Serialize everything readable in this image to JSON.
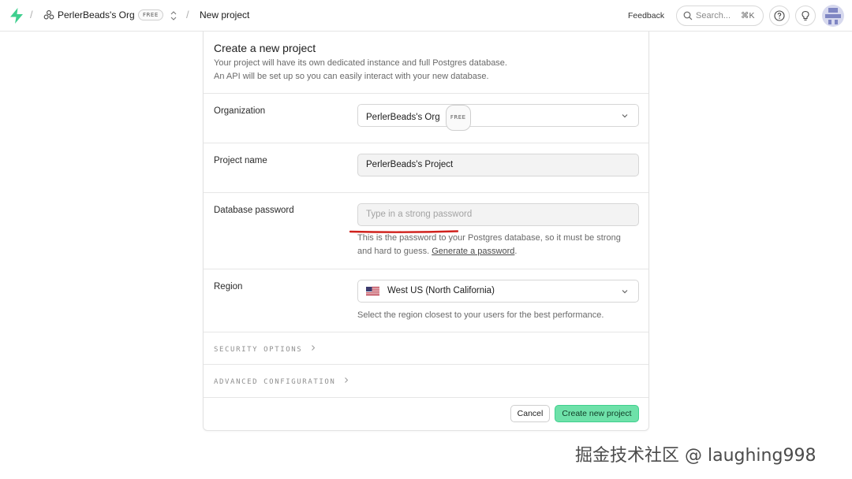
{
  "topbar": {
    "org_name": "PerlerBeads's Org",
    "org_badge": "FREE",
    "project_crumb": "New project",
    "feedback_label": "Feedback",
    "search_placeholder": "Search...",
    "search_shortcut": "⌘K",
    "icons": [
      "supabase-logo-icon",
      "org-icon",
      "switch-icon",
      "search-icon",
      "help-icon",
      "lightbulb-icon",
      "avatar"
    ]
  },
  "form": {
    "title": "Create a new project",
    "description_line1": "Your project will have its own dedicated instance and full Postgres database.",
    "description_line2": "An API will be set up so you can easily interact with your new database.",
    "organization": {
      "label": "Organization",
      "value": "PerlerBeads's Org",
      "badge": "FREE"
    },
    "project_name": {
      "label": "Project name",
      "value": "PerlerBeads's Project"
    },
    "database_password": {
      "label": "Database password",
      "value": "",
      "placeholder": "Type in a strong password",
      "helper_text": "This is the password to your Postgres database, so it must be strong and hard to guess.",
      "helper_link": "Generate a password",
      "helper_end": "."
    },
    "region": {
      "label": "Region",
      "value": "West US (North California)",
      "helper_text": "Select the region closest to your users for the best performance."
    },
    "security_options_label": "SECURITY OPTIONS",
    "advanced_configuration_label": "ADVANCED CONFIGURATION",
    "cancel_label": "Cancel",
    "create_label": "Create new project"
  },
  "colors": {
    "brand_green": "#3ecf8e",
    "create_button_bg": "#6ee1a9",
    "annotation_red": "#d0211c"
  },
  "watermark": "掘金技术社区 @ laughing998"
}
